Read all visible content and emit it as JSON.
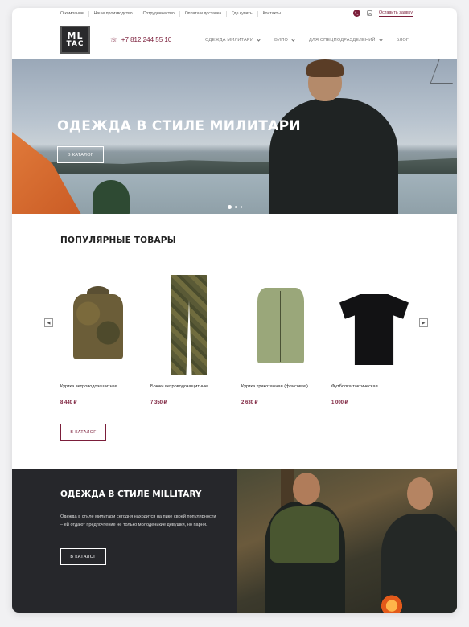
{
  "topbar": {
    "links": [
      "О компании",
      "Наше производство",
      "Сотрудничество",
      "Оплата и доставка",
      "Где купить",
      "Контакты"
    ],
    "cta": "Оставить заявку"
  },
  "header": {
    "logo_line1": "ML",
    "logo_line2": "TAC",
    "phone": "+7 812 244 55 10",
    "nav": [
      {
        "label": "ОДЕЖДА МИЛИТАРИ"
      },
      {
        "label": "ВИПО"
      },
      {
        "label": "ДЛЯ СПЕЦПОДРАЗДЕЛЕНИЙ"
      },
      {
        "label": "БЛОГ"
      }
    ]
  },
  "hero": {
    "title": "ОДЕЖДА В СТИЛЕ МИЛИТАРИ",
    "button": "В КАТАЛОГ"
  },
  "popular": {
    "title": "ПОПУЛЯРНЫЕ ТОВАРЫ",
    "products": [
      {
        "name": "Куртка ветроводозащитная",
        "price": "8 440 ₽"
      },
      {
        "name": "Брюки ветроводозащитные",
        "price": "7 350 ₽"
      },
      {
        "name": "Куртка трикотажная (флисовая)",
        "price": "2 630 ₽"
      },
      {
        "name": "Футболка тактическая",
        "price": "1 000 ₽"
      }
    ],
    "button": "В КАТАЛОГ"
  },
  "promo": {
    "title": "ОДЕЖДА В СТИЛЕ MILLITARY",
    "text": "Одежда в стиле милитари сегодня находится на пике своей популярности – ей отдают предпочтение не только молоденькие девушки, но парни.",
    "button": "В КАТАЛОГ"
  },
  "colors": {
    "accent": "#7b1e3a",
    "dark": "#26272b"
  }
}
